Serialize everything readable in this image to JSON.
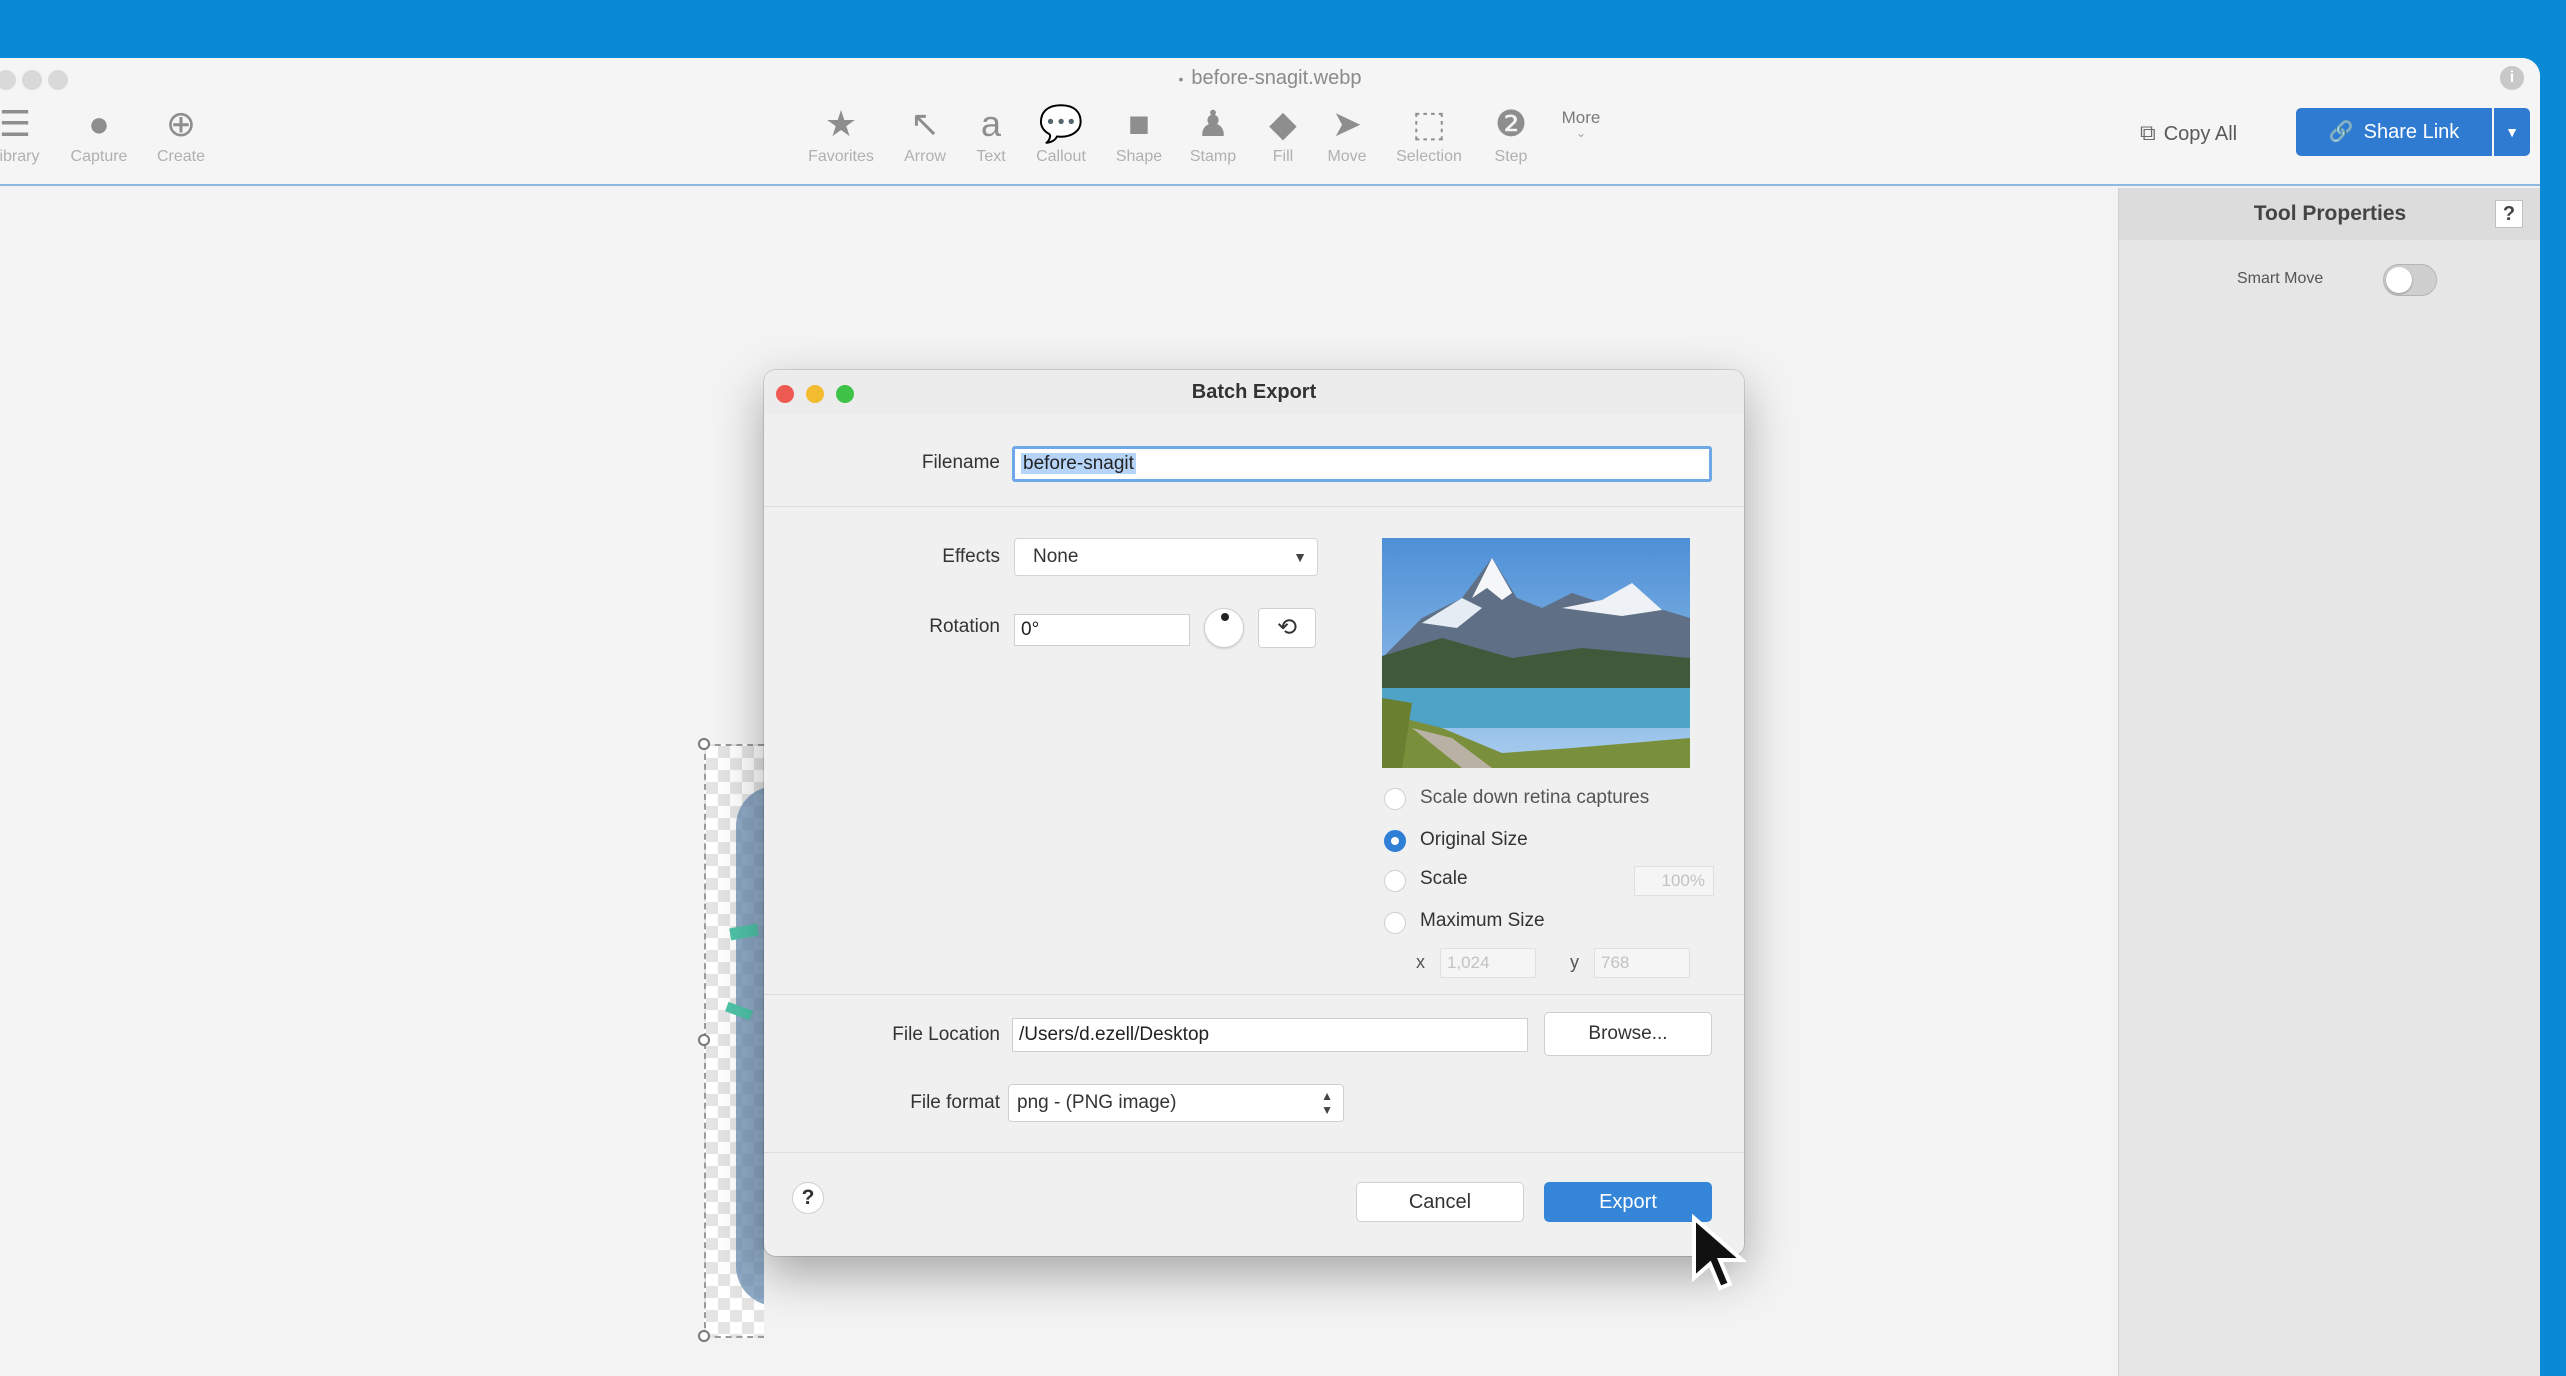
{
  "window": {
    "title": "before-snagit.webp"
  },
  "toolbar": {
    "left_items": [
      {
        "label": "Library",
        "icon": "library-icon"
      },
      {
        "label": "Capture",
        "icon": "capture-icon"
      },
      {
        "label": "Create",
        "icon": "create-icon"
      }
    ],
    "tools": [
      {
        "label": "Favorites",
        "icon": "star-icon"
      },
      {
        "label": "Arrow",
        "icon": "arrow-icon"
      },
      {
        "label": "Text",
        "icon": "text-icon"
      },
      {
        "label": "Callout",
        "icon": "callout-icon"
      },
      {
        "label": "Shape",
        "icon": "shape-icon"
      },
      {
        "label": "Stamp",
        "icon": "stamp-icon"
      },
      {
        "label": "Fill",
        "icon": "fill-icon"
      },
      {
        "label": "Move",
        "icon": "move-icon"
      },
      {
        "label": "Selection",
        "icon": "selection-icon"
      },
      {
        "label": "Step",
        "icon": "step-icon"
      }
    ],
    "more_label": "More",
    "copy_all_label": "Copy All",
    "share_link_label": "Share Link"
  },
  "tool_properties": {
    "title": "Tool Properties",
    "help": "?",
    "smart_move_label": "Smart Move",
    "smart_move_on": false
  },
  "dialog": {
    "title": "Batch Export",
    "filename_label": "Filename",
    "filename_value": "before-snagit",
    "effects_label": "Effects",
    "effects_value": "None",
    "rotation_label": "Rotation",
    "rotation_value": "0°",
    "scale_down_retina_label": "Scale down retina captures",
    "size_options": [
      {
        "label": "Original Size",
        "selected": true
      },
      {
        "label": "Scale",
        "selected": false
      },
      {
        "label": "Maximum Size",
        "selected": false
      }
    ],
    "scale_value": "100%",
    "max_x_label": "x",
    "max_x_value": "1,024",
    "max_y_label": "y",
    "max_y_value": "768",
    "file_location_label": "File Location",
    "file_location_value": "/Users/d.ezell/Desktop",
    "browse_label": "Browse...",
    "file_format_label": "File format",
    "file_format_value": "png - (PNG image)",
    "help": "?",
    "cancel_label": "Cancel",
    "export_label": "Export"
  },
  "colors": {
    "accent": "#2e7bd1",
    "desktop": "#0a8ad6"
  }
}
